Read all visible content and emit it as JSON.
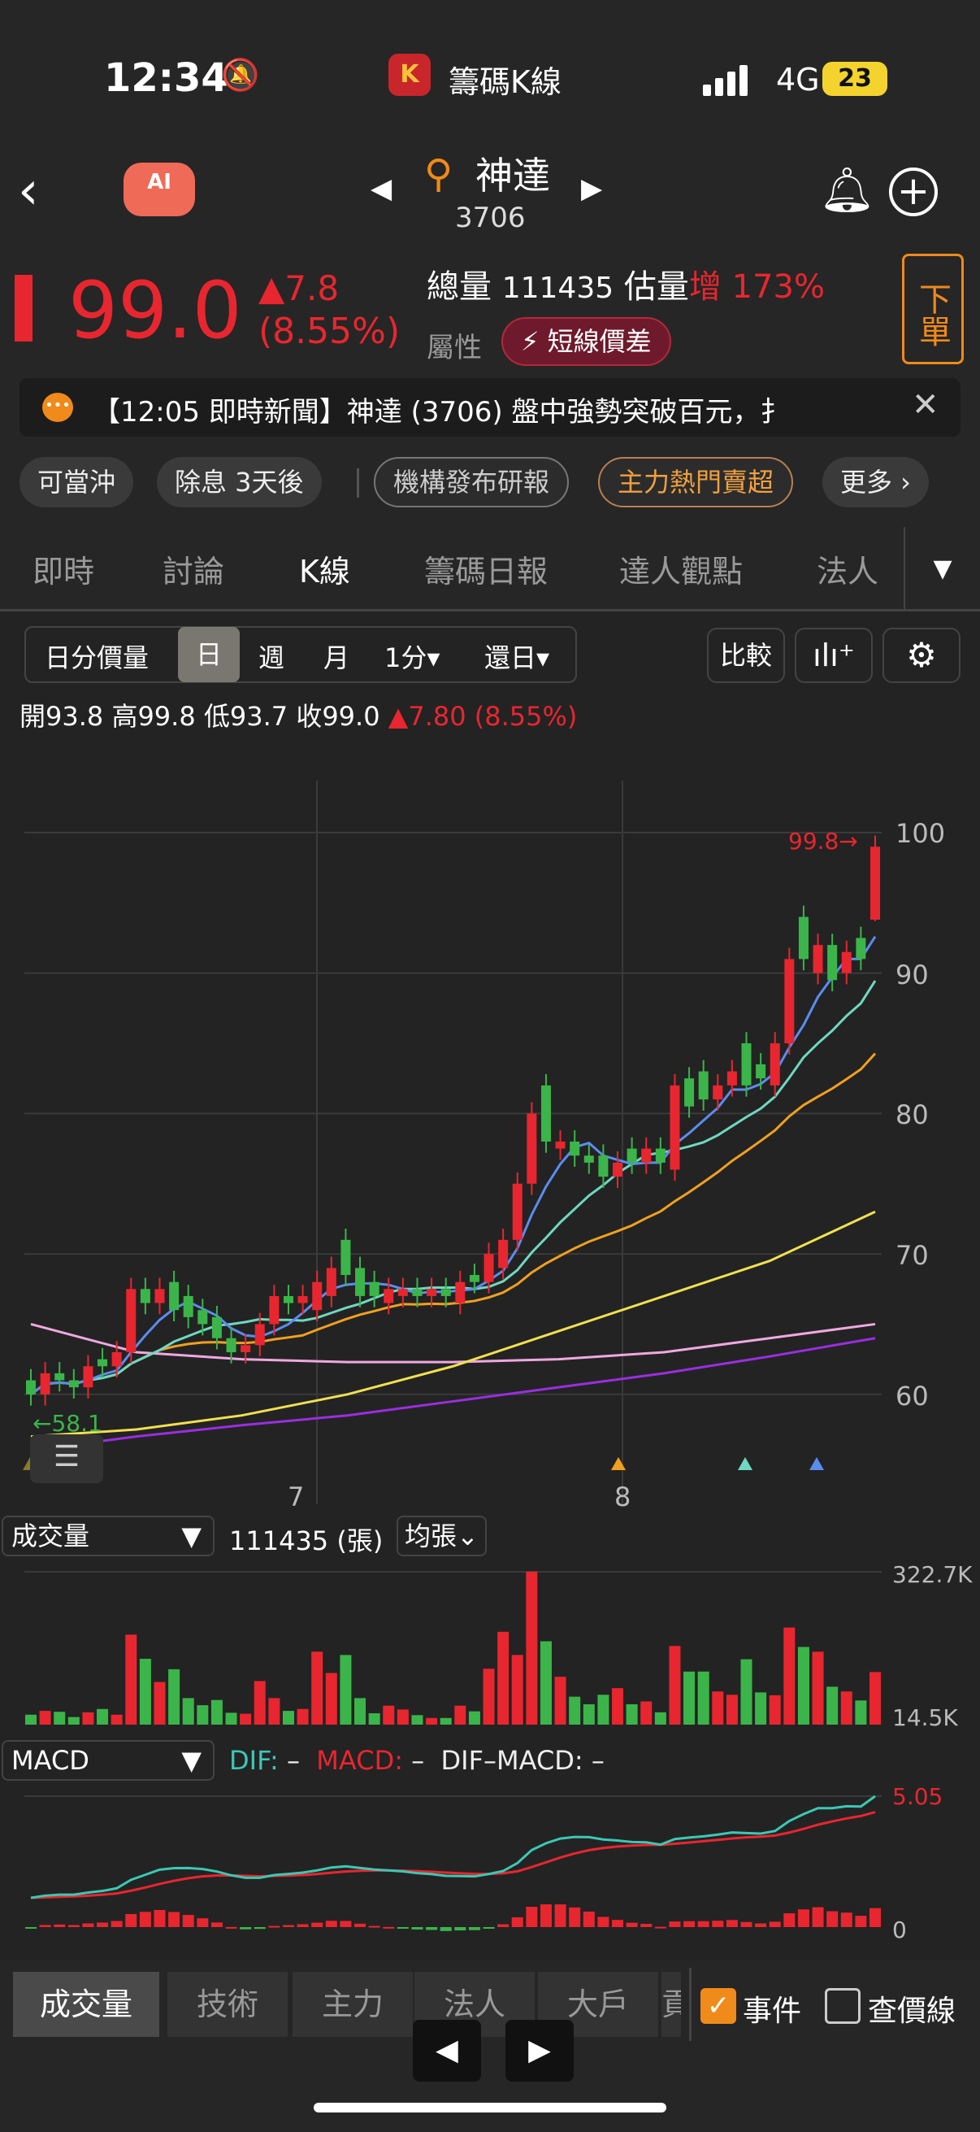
{
  "status": {
    "time": "12:34",
    "app": "籌碼K線",
    "network": "4G",
    "battery": "23"
  },
  "header": {
    "name": "神達",
    "code": "3706",
    "ai": "AI"
  },
  "quote": {
    "price": "99.0",
    "change": "▲7.8",
    "pct": "(8.55%)",
    "vol_label": "總量",
    "volume": "111435",
    "est_label": "估量",
    "est_tag": "增",
    "est_pct": "173%",
    "attr_label": "屬性",
    "attr_badge": "短線價差",
    "order": "下單"
  },
  "news": {
    "text": "【12:05 即時新聞】神達 (3706) 盤中強勢突破百元，扌"
  },
  "chips": [
    "可當沖",
    "除息 3天後",
    "機構發布研報",
    "主力熱門賣超",
    "更多 ›"
  ],
  "tabs": [
    "即時",
    "討論",
    "K線",
    "籌碼日報",
    "達人觀點",
    "法人"
  ],
  "toolbar": {
    "items": [
      "日分價量",
      "日",
      "週",
      "月",
      "1分▾",
      "還日▾"
    ],
    "compare": "比較"
  },
  "ohlc": {
    "open": "開93.8",
    "high": "高99.8",
    "low": "低93.7",
    "close": "收99.0",
    "change": "▲7.80 (8.55%)"
  },
  "colors": {
    "up": "#e8262f",
    "down": "#3bb54a",
    "ma5": "#5b8cf0",
    "ma10": "#6fd8c0",
    "ma20": "#f0a020",
    "ma60": "#f0e050",
    "ma120": "#f0a8e0",
    "ma240": "#9a2ee0"
  },
  "chart_data": {
    "type": "candlestick",
    "y_ticks": [
      "100",
      "90",
      "80",
      "70",
      "60"
    ],
    "x_ticks": [
      "7",
      "8"
    ],
    "high_marker": "99.8→",
    "low_marker": "←58.1",
    "open": [
      61,
      60,
      61.5,
      61,
      60.5,
      62.5,
      62,
      63,
      67.5,
      66.5,
      68,
      67,
      66,
      65.5,
      64,
      63,
      63.5,
      65,
      67,
      66.5,
      66,
      67,
      71,
      69,
      68,
      66.5,
      67,
      67.5,
      67,
      67.5,
      66.5,
      68.5,
      68,
      69,
      71,
      75,
      82,
      77.5,
      78,
      77,
      77,
      75.5,
      77.5,
      76.5,
      77.5,
      76,
      82.5,
      83,
      81,
      82,
      85,
      83.5,
      82,
      85,
      94,
      90,
      92,
      90,
      92.5,
      93.8
    ],
    "close": [
      60,
      61.5,
      61,
      60.5,
      62,
      62,
      63,
      67.5,
      66.5,
      67.5,
      66,
      65.5,
      65,
      64,
      63,
      63.5,
      65,
      67,
      66.5,
      67,
      68,
      69,
      68.5,
      67,
      67,
      67.5,
      67.5,
      67,
      67.5,
      67,
      68,
      68,
      70,
      71,
      75,
      80,
      78,
      78,
      77,
      76.5,
      75.5,
      76.5,
      76.5,
      77.5,
      76.5,
      82,
      80.5,
      81,
      82,
      83,
      82,
      82.5,
      85,
      91,
      91,
      92,
      89.5,
      91.5,
      91,
      99
    ],
    "ma60": [
      57,
      57.5,
      58.5,
      60,
      62,
      64.5,
      67,
      69.5,
      73
    ],
    "ma120": [
      65,
      63,
      62.5,
      62.3,
      62.3,
      62.5,
      63,
      64,
      65
    ],
    "ma240": [
      56,
      57,
      57.8,
      58.5,
      59.5,
      60.5,
      61.5,
      62.7,
      64
    ],
    "volume": {
      "label": "成交量",
      "value": "111435 (張)",
      "unit": "均張⌄",
      "max": "322.7K",
      "min": "14.5K",
      "values": [
        21,
        29,
        27,
        16,
        26,
        33,
        21,
        190,
        139,
        90,
        117,
        56,
        41,
        52,
        25,
        23,
        92,
        56,
        29,
        33,
        154,
        109,
        147,
        56,
        24,
        40,
        32,
        20,
        14,
        14,
        40,
        28,
        118,
        196,
        147,
        323,
        176,
        101,
        59,
        43,
        63,
        77,
        43,
        49,
        26,
        166,
        112,
        112,
        70,
        63,
        138,
        68,
        62,
        205,
        164,
        154,
        80,
        70,
        51,
        111
      ]
    },
    "macd": {
      "label": "MACD",
      "dif": "DIF:",
      "dif_v": "–",
      "macd": "MACD:",
      "macd_v": "–",
      "osc": "DIF–MACD:",
      "osc_v": "–",
      "max": "5.05",
      "zero": "0"
    }
  },
  "bottom": {
    "tabs": [
      "成交量",
      "技術",
      "主力",
      "法人",
      "大戶",
      "貢"
    ],
    "event": "事件",
    "lookup": "查價線"
  }
}
